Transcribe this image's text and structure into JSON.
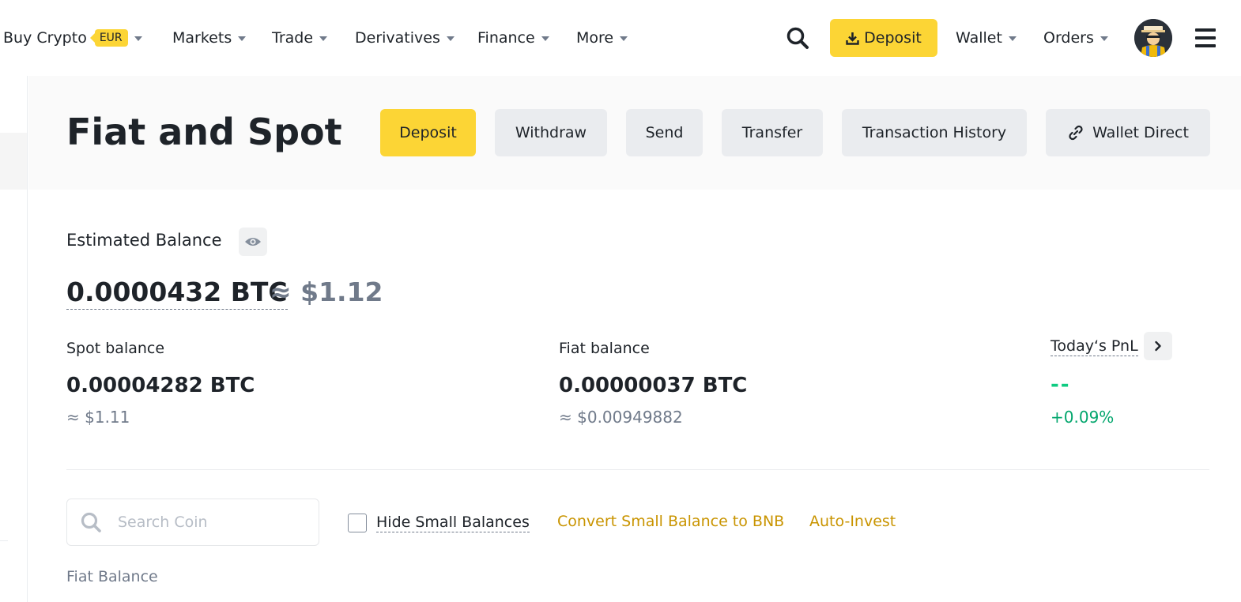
{
  "nav": {
    "items": [
      {
        "label": "Buy Crypto",
        "badge": "EUR"
      },
      {
        "label": "Markets"
      },
      {
        "label": "Trade"
      },
      {
        "label": "Derivatives"
      },
      {
        "label": "Finance"
      },
      {
        "label": "More"
      }
    ],
    "deposit_label": "Deposit",
    "wallet_label": "Wallet",
    "orders_label": "Orders",
    "icons": [
      "search-icon",
      "download-icon",
      "avatar",
      "hamburger-menu-icon"
    ]
  },
  "header": {
    "title": "Fiat and Spot",
    "buttons": {
      "deposit": "Deposit",
      "withdraw": "Withdraw",
      "send": "Send",
      "transfer": "Transfer",
      "history": "Transaction History",
      "wallet_direct": "Wallet Direct"
    }
  },
  "balance": {
    "estimated_label": "Estimated Balance",
    "btc": "0.0000432 BTC",
    "usd": "≈ $1.12",
    "spot": {
      "label": "Spot balance",
      "value": "0.00004282 BTC",
      "approx": "≈ $1.11"
    },
    "fiat": {
      "label": "Fiat balance",
      "value": "0.00000037 BTC",
      "approx": "≈ $0.00949882"
    },
    "pnl": {
      "label": "Today‘s PnL",
      "value": "--",
      "percent": "+0.09%"
    }
  },
  "toolbar": {
    "search_placeholder": "Search Coin",
    "hide_small_label": "Hide Small Balances",
    "hide_small_checked": false,
    "convert_label": "Convert Small Balance to BNB",
    "auto_invest_label": "Auto-Invest"
  },
  "section": {
    "fiat_balance_heading": "Fiat Balance"
  },
  "colors": {
    "accent": "#fcd535",
    "text_primary": "#1e2329",
    "text_secondary": "#707a8a",
    "link_gold": "#c99400",
    "positive": "#03a66d",
    "button_gray": "#eaecef",
    "band_bg": "#fafafa"
  }
}
